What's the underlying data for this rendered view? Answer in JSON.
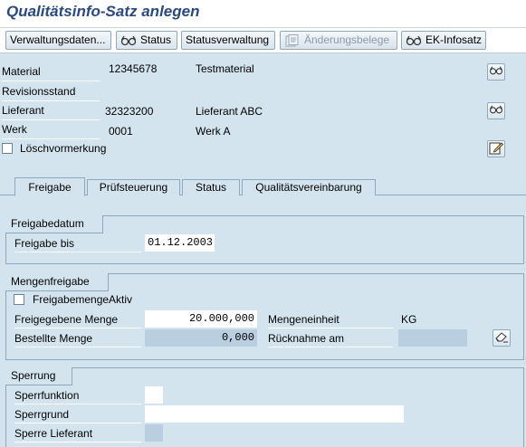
{
  "title": "Qualitätsinfo-Satz anlegen",
  "toolbar": {
    "verwaltungsdaten": "Verwaltungsdaten...",
    "status": "Status",
    "statusverwaltung": "Statusverwaltung",
    "aenderungsbelege": "Änderungsbelege",
    "ek_infosatz": "EK-Infosatz"
  },
  "header": {
    "material_label": "Material",
    "material_value": "12345678",
    "material_text": "Testmaterial",
    "revisionsstand_label": "Revisionsstand",
    "lieferant_label": "Lieferant",
    "lieferant_value": "32323200",
    "lieferant_text": "Lieferant ABC",
    "werk_label": "Werk",
    "werk_value": "0001",
    "werk_text": "Werk A",
    "loeschvormerkung_label": "Löschvormerkung"
  },
  "tabs": [
    {
      "label": "Freigabe",
      "active": true
    },
    {
      "label": "Prüfsteuerung",
      "active": false
    },
    {
      "label": "Status",
      "active": false
    },
    {
      "label": "Qualitätsvereinbarung",
      "active": false
    }
  ],
  "freigabedatum": {
    "title": "Freigabedatum",
    "freigabe_bis_label": "Freigabe bis",
    "freigabe_bis_value": "01.12.2003"
  },
  "mengenfreigabe": {
    "title": "Mengenfreigabe",
    "aktiv_label": "FreigabemengeAktiv",
    "freigegebene_menge_label": "Freigegebene Menge",
    "freigegebene_menge_value": "20.000,000",
    "mengeneinheit_label": "Mengeneinheit",
    "mengeneinheit_value": "KG",
    "bestellte_menge_label": "Bestellte Menge",
    "bestellte_menge_value": "0,000",
    "ruecknahme_label": "Rücknahme am",
    "ruecknahme_value": ""
  },
  "sperrung": {
    "title": "Sperrung",
    "sperrfunktion_label": "Sperrfunktion",
    "sperrgrund_label": "Sperrgrund",
    "sperre_lieferant_label": "Sperre Lieferant"
  },
  "colors": {
    "background": "#d4e4ef",
    "title": "#2a4a7c",
    "field_readonly": "#b9cfe0",
    "border": "#8ea8bc"
  }
}
